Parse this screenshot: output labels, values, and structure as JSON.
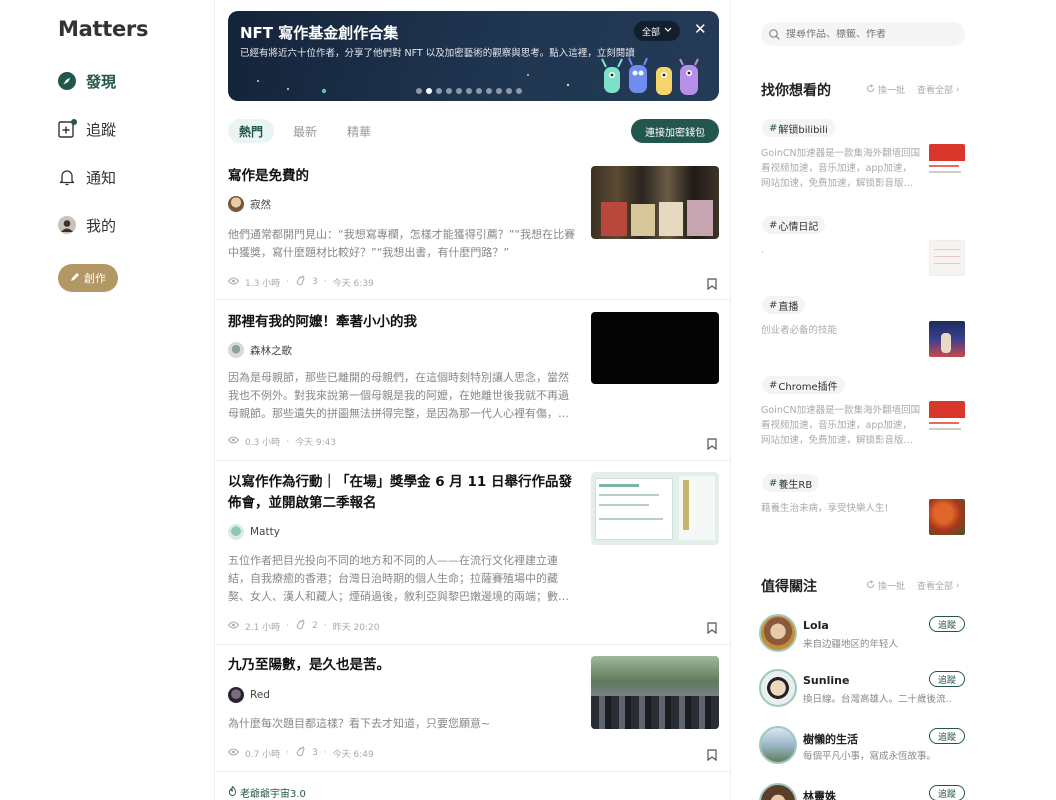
{
  "nav": {
    "logo": "Matters",
    "items": [
      {
        "label": "發現",
        "icon": "compass-icon",
        "active": true
      },
      {
        "label": "追蹤",
        "icon": "follow-feed-icon",
        "active": false
      },
      {
        "label": "通知",
        "icon": "bell-icon",
        "active": false
      },
      {
        "label": "我的",
        "icon": "avatar",
        "active": false
      }
    ],
    "create_label": "創作"
  },
  "banner": {
    "title": "NFT 寫作基金創作合集",
    "description": "已經有將近六十位作者，分享了他們對 NFT 以及加密藝術的觀察與思考。點入這裡，立刻閱讀",
    "filter_label": "全部",
    "slide_count": 11,
    "active_slide": 1
  },
  "tabs": {
    "items": [
      "熱門",
      "最新",
      "精華"
    ],
    "active": "熱門",
    "wallet_button": "連接加密錢包"
  },
  "articles": [
    {
      "title": "寫作是免費的",
      "author": "寂然",
      "summary": "他們通常都開門見山：“我想寫專欄，怎樣才能獲得引薦？”“我想在比賽中獲獎，寫什麼題材比較好？”“我想出書，有什麼門路？”",
      "read_time": "1.3 小時",
      "appreciations": "3",
      "time": "今天 6:39"
    },
    {
      "title": "那裡有我的阿嬤！牽著小小的我",
      "author": "森林之歌",
      "summary": "因為是母親節，那些已離開的母親們，在這個時刻特別讓人思念，當然我也不例外。對我來說第一個母親是我的阿嬤，在她離世後我就不再過母親節。那些遺失的拼圖無法拼得完整，是因為那一代人心裡有傷，…",
      "read_time": "0.3 小時",
      "appreciations": "",
      "time": "今天 9:43"
    },
    {
      "title": "以寫作作為行動｜「在場」獎學金 6 月 11 日舉行作品發佈會，並開啟第二季報名",
      "author": "Matty",
      "summary": "五位作者把目光投向不同的地方和不同的人——在流行文化裡建立連結，自我療癒的香港；台灣日治時期的個人生命；拉薩賽殖場中的藏獒、女人、漢人和藏人；煙硝過後，敘利亞與黎巴嫩邊境的兩端；數…",
      "read_time": "2.1 小時",
      "appreciations": "2",
      "time": "昨天 20:20"
    },
    {
      "title": "九乃至陽數，是久也是苦。",
      "author": "Red",
      "summary": "為什麼每次題目都這樣？看下去才知道，只要您願意~",
      "read_time": "0.7 小時",
      "appreciations": "3",
      "time": "今天 6:49"
    }
  ],
  "circle_link": "老爺爺宇宙3.0",
  "search": {
    "placeholder": "搜尋作品、標籤、作者"
  },
  "tags_section": {
    "title": "找你想看的",
    "shuffle": "換一批",
    "view_all": "查看全部",
    "items": [
      {
        "tag": "解锁bilibili",
        "desc": "GoinCN加速器是一款集海外翻墙回国看视频加速，音乐加速，app加速，网站加速，免费加速，解锁影音版…"
      },
      {
        "tag": "心情日記",
        "desc": "."
      },
      {
        "tag": "直播",
        "desc": "创业者必备的技能"
      },
      {
        "tag": "Chrome插件",
        "desc": "GoinCN加速器是一款集海外翻墙回国看视频加速，音乐加速，app加速，网站加速，免费加速，解锁影音版…"
      },
      {
        "tag": "養生RB",
        "desc": "藉養生治未病，享受快樂人生!"
      }
    ]
  },
  "users_section": {
    "title": "值得關注",
    "shuffle": "換一批",
    "view_all": "查看全部",
    "follow_label": "追蹤",
    "items": [
      {
        "name": "Lola",
        "bio": "来自边疆地区的年轻人"
      },
      {
        "name": "Sunline",
        "bio": "換日線。台灣高雄人。二十歲後流…"
      },
      {
        "name": "樹懶的生活",
        "bio": "每個平凡小事，寫成永恆故事。"
      },
      {
        "name": "林靈姝",
        "bio": ""
      }
    ]
  },
  "colors": {
    "brand": "#23574d",
    "gold": "#b39765",
    "banner_bg": "#1a2d45"
  }
}
